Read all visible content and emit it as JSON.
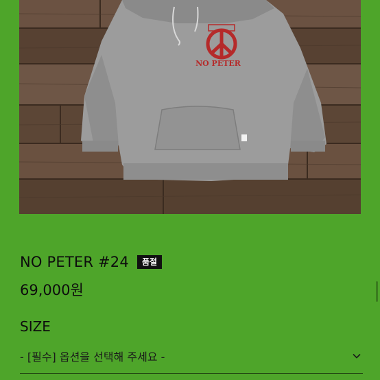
{
  "product": {
    "image_alt": "NO PETER hoodie",
    "print_text": "NO PETER",
    "title": "NO PETER #24",
    "badge": "품절",
    "price": "69,000원"
  },
  "options": {
    "label": "SIZE",
    "placeholder": "- [필수] 옵션을 선택해 주세요 -"
  },
  "icons": {
    "select_chevron": "chevron-down-icon",
    "peace_sign": "peace-logo-icon"
  },
  "colors": {
    "background": "#4ea52a",
    "badge_bg": "#111111",
    "print_red": "#b52a2a"
  }
}
